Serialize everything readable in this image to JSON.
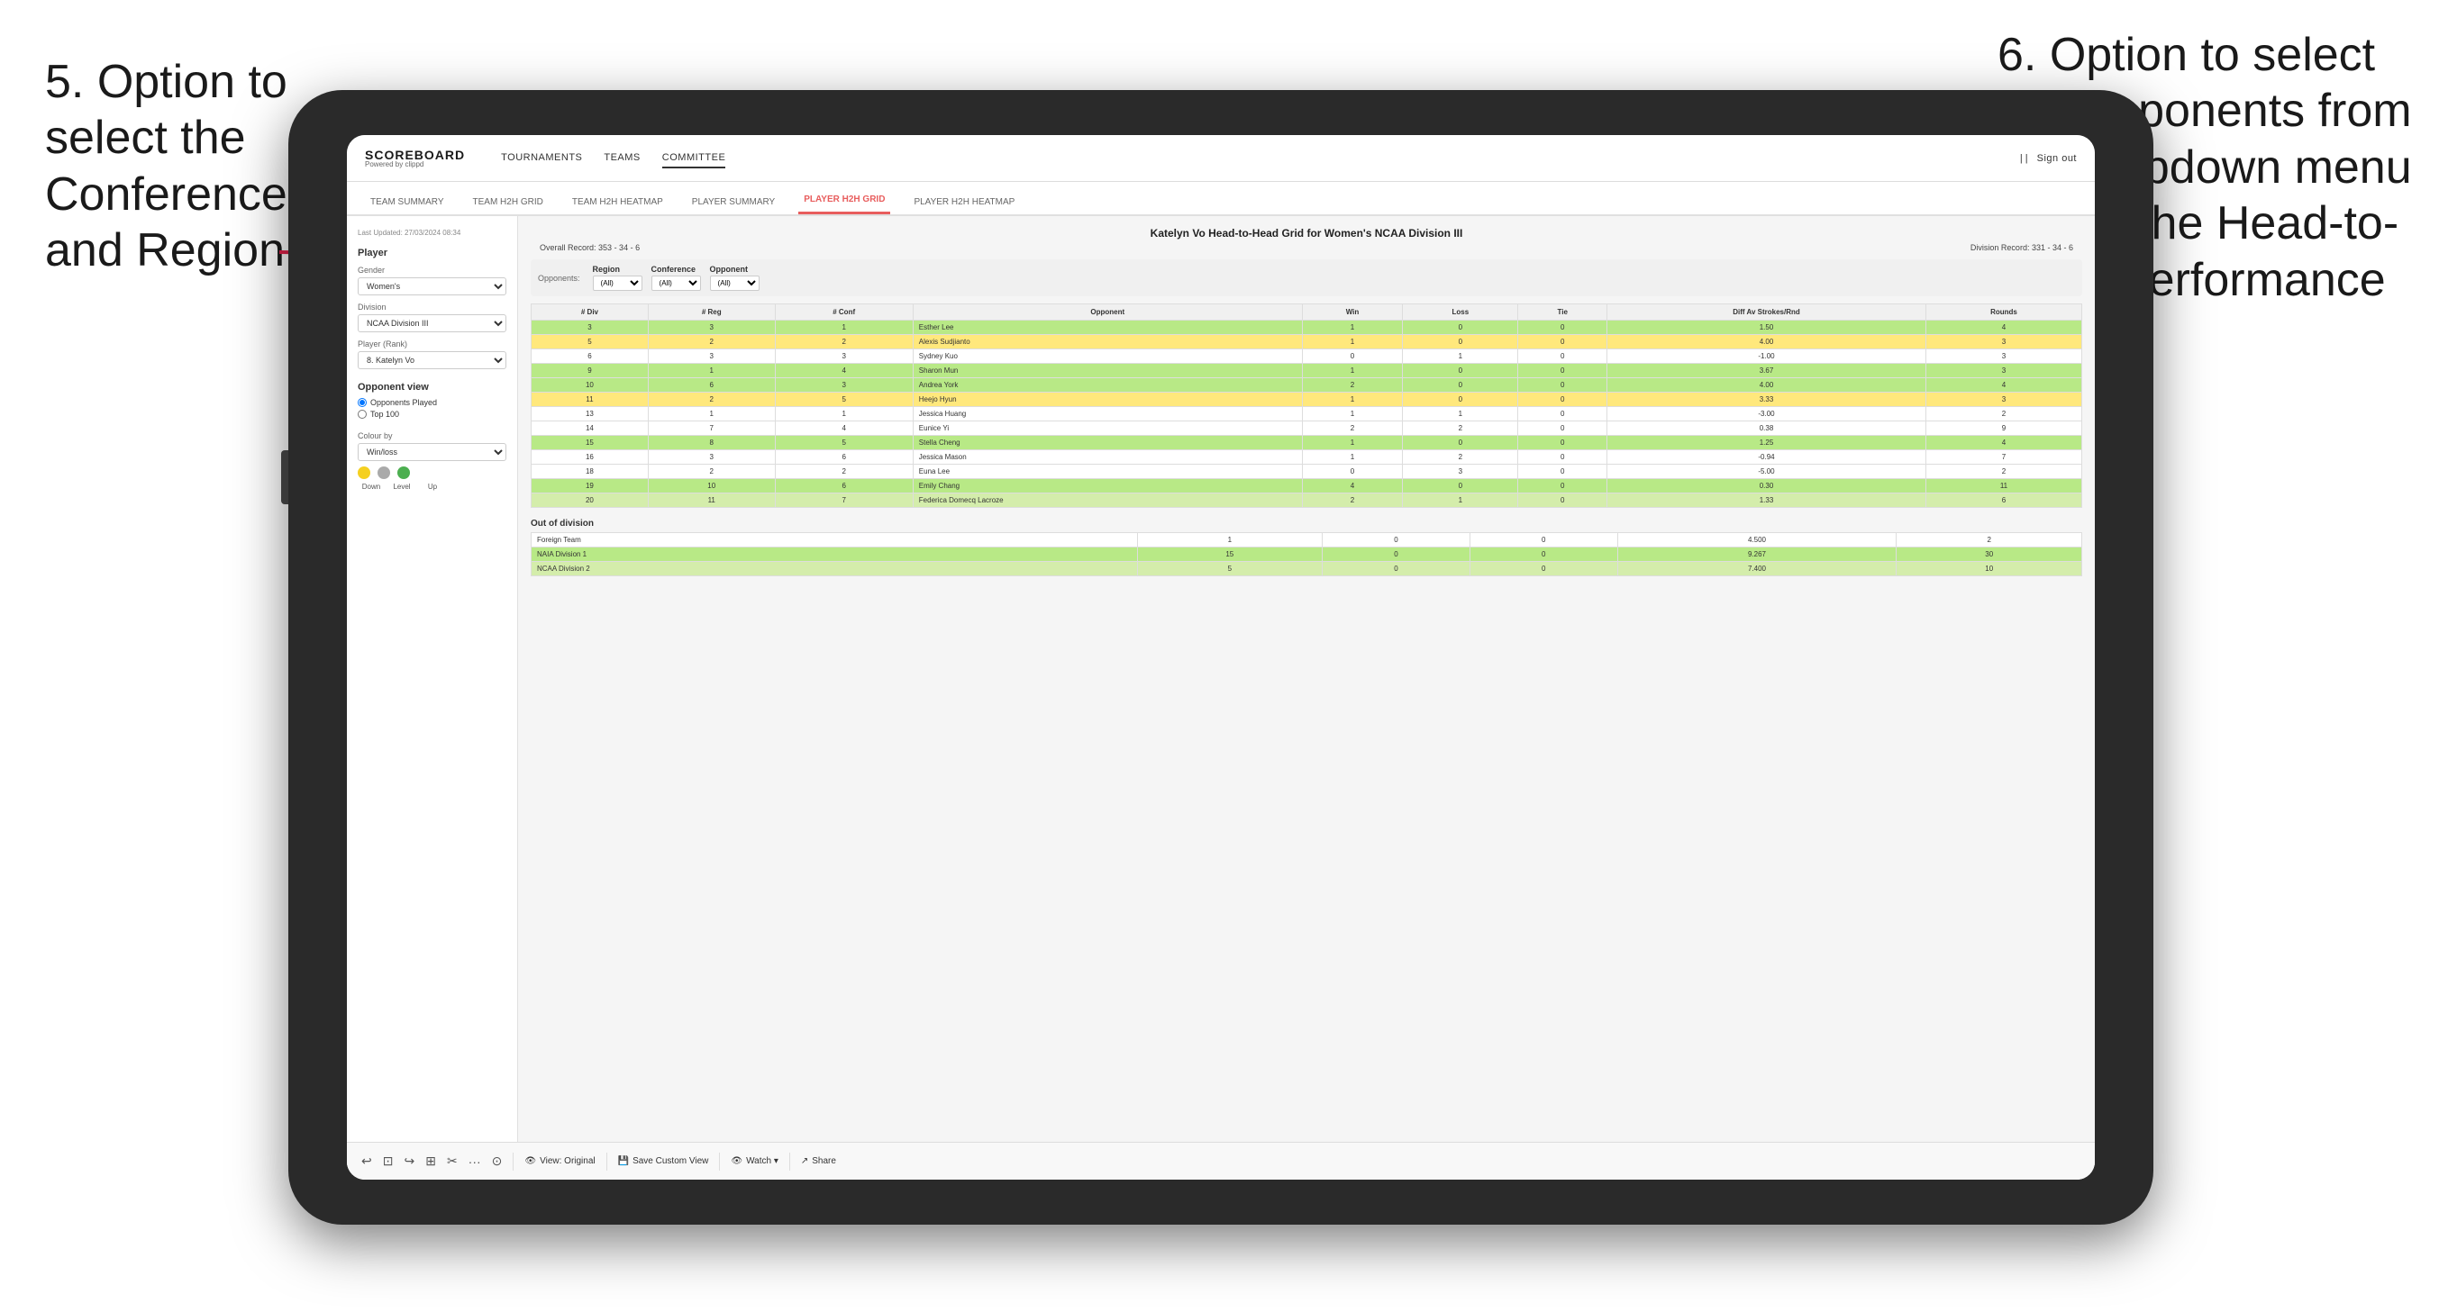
{
  "annotations": {
    "left": {
      "text": "5. Option to select the Conference and Region"
    },
    "right": {
      "text": "6. Option to select the Opponents from the dropdown menu to see the Head-to-Head performance"
    }
  },
  "app": {
    "logo": {
      "main": "SCOREBOARD",
      "sub": "Powered by clippd"
    },
    "nav_items": [
      "TOURNAMENTS",
      "TEAMS",
      "COMMITTEE"
    ],
    "nav_active": "COMMITTEE",
    "sign_out": "Sign out",
    "sub_nav": [
      "TEAM SUMMARY",
      "TEAM H2H GRID",
      "TEAM H2H HEATMAP",
      "PLAYER SUMMARY",
      "PLAYER H2H GRID",
      "PLAYER H2H HEATMAP"
    ],
    "sub_nav_active": "PLAYER H2H GRID"
  },
  "sidebar": {
    "last_updated": "Last Updated: 27/03/2024 08:34",
    "player_label": "Player",
    "gender_label": "Gender",
    "gender_value": "Women's",
    "division_label": "Division",
    "division_value": "NCAA Division III",
    "player_rank_label": "Player (Rank)",
    "player_rank_value": "8. Katelyn Vo",
    "opponent_view_label": "Opponent view",
    "opponent_options": [
      "Opponents Played",
      "Top 100"
    ],
    "opponent_selected": "Opponents Played",
    "colour_by_label": "Colour by",
    "colour_by_value": "Win/loss",
    "colour_labels": [
      "Down",
      "Level",
      "Up"
    ]
  },
  "report": {
    "title": "Katelyn Vo Head-to-Head Grid for Women's NCAA Division III",
    "overall_record_label": "Overall Record:",
    "overall_record": "353 - 34 - 6",
    "division_record_label": "Division Record:",
    "division_record": "331 - 34 - 6",
    "filters": {
      "opponents_label": "Opponents:",
      "region_label": "Region",
      "region_value": "(All)",
      "conference_label": "Conference",
      "conference_value": "(All)",
      "opponent_label": "Opponent",
      "opponent_value": "(All)"
    },
    "table_headers": [
      "# Div",
      "# Reg",
      "# Conf",
      "Opponent",
      "Win",
      "Loss",
      "Tie",
      "Diff Av Strokes/Rnd",
      "Rounds"
    ],
    "rows": [
      {
        "div": "3",
        "reg": "3",
        "conf": "1",
        "opponent": "Esther Lee",
        "win": "1",
        "loss": "0",
        "tie": "0",
        "diff": "1.50",
        "rounds": "4",
        "color": "green"
      },
      {
        "div": "5",
        "reg": "2",
        "conf": "2",
        "opponent": "Alexis Sudjianto",
        "win": "1",
        "loss": "0",
        "tie": "0",
        "diff": "4.00",
        "rounds": "3",
        "color": "yellow"
      },
      {
        "div": "6",
        "reg": "3",
        "conf": "3",
        "opponent": "Sydney Kuo",
        "win": "0",
        "loss": "1",
        "tie": "0",
        "diff": "-1.00",
        "rounds": "3",
        "color": "none"
      },
      {
        "div": "9",
        "reg": "1",
        "conf": "4",
        "opponent": "Sharon Mun",
        "win": "1",
        "loss": "0",
        "tie": "0",
        "diff": "3.67",
        "rounds": "3",
        "color": "green"
      },
      {
        "div": "10",
        "reg": "6",
        "conf": "3",
        "opponent": "Andrea York",
        "win": "2",
        "loss": "0",
        "tie": "0",
        "diff": "4.00",
        "rounds": "4",
        "color": "green"
      },
      {
        "div": "11",
        "reg": "2",
        "conf": "5",
        "opponent": "Heejo Hyun",
        "win": "1",
        "loss": "0",
        "tie": "0",
        "diff": "3.33",
        "rounds": "3",
        "color": "yellow"
      },
      {
        "div": "13",
        "reg": "1",
        "conf": "1",
        "opponent": "Jessica Huang",
        "win": "1",
        "loss": "1",
        "tie": "0",
        "diff": "-3.00",
        "rounds": "2",
        "color": "none"
      },
      {
        "div": "14",
        "reg": "7",
        "conf": "4",
        "opponent": "Eunice Yi",
        "win": "2",
        "loss": "2",
        "tie": "0",
        "diff": "0.38",
        "rounds": "9",
        "color": "none"
      },
      {
        "div": "15",
        "reg": "8",
        "conf": "5",
        "opponent": "Stella Cheng",
        "win": "1",
        "loss": "0",
        "tie": "0",
        "diff": "1.25",
        "rounds": "4",
        "color": "green"
      },
      {
        "div": "16",
        "reg": "3",
        "conf": "6",
        "opponent": "Jessica Mason",
        "win": "1",
        "loss": "2",
        "tie": "0",
        "diff": "-0.94",
        "rounds": "7",
        "color": "none"
      },
      {
        "div": "18",
        "reg": "2",
        "conf": "2",
        "opponent": "Euna Lee",
        "win": "0",
        "loss": "3",
        "tie": "0",
        "diff": "-5.00",
        "rounds": "2",
        "color": "none"
      },
      {
        "div": "19",
        "reg": "10",
        "conf": "6",
        "opponent": "Emily Chang",
        "win": "4",
        "loss": "0",
        "tie": "0",
        "diff": "0.30",
        "rounds": "11",
        "color": "green"
      },
      {
        "div": "20",
        "reg": "11",
        "conf": "7",
        "opponent": "Federica Domecq Lacroze",
        "win": "2",
        "loss": "1",
        "tie": "0",
        "diff": "1.33",
        "rounds": "6",
        "color": "light-green"
      }
    ],
    "out_of_division_title": "Out of division",
    "out_of_division_rows": [
      {
        "label": "Foreign Team",
        "win": "1",
        "loss": "0",
        "tie": "0",
        "diff": "4.500",
        "rounds": "2",
        "color": "none"
      },
      {
        "label": "NAIA Division 1",
        "win": "15",
        "loss": "0",
        "tie": "0",
        "diff": "9.267",
        "rounds": "30",
        "color": "green"
      },
      {
        "label": "NCAA Division 2",
        "win": "5",
        "loss": "0",
        "tie": "0",
        "diff": "7.400",
        "rounds": "10",
        "color": "light-green"
      }
    ]
  },
  "toolbar": {
    "icons": [
      "↩",
      "⊡",
      "↪",
      "⊞",
      "✂",
      "·",
      "⊙"
    ],
    "view_original": "View: Original",
    "save_custom_view": "Save Custom View",
    "watch": "Watch ▾",
    "share": "Share"
  }
}
